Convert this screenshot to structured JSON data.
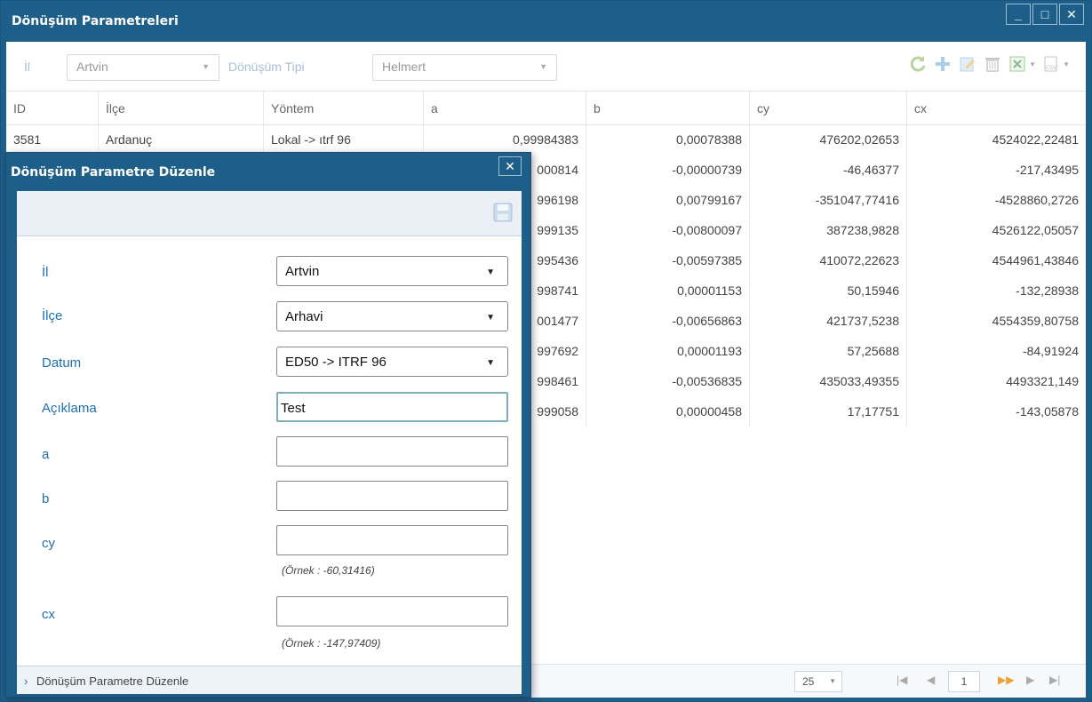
{
  "main": {
    "title": "Dönüşüm Parametreleri",
    "win_minimize": "_",
    "win_maximize": "□",
    "win_close": "✕"
  },
  "toolbar": {
    "il_label": "İl",
    "il_value": "Artvin",
    "tip_label": "Dönüşüm Tipi",
    "tip_value": "Helmert",
    "icons": [
      "refresh-icon",
      "add-icon",
      "edit-icon",
      "delete-icon",
      "excel-export-icon",
      "csv-export-icon"
    ]
  },
  "grid": {
    "headers": [
      "ID",
      "İlçe",
      "Yöntem",
      "a",
      "b",
      "cy",
      "cx"
    ],
    "rows": [
      [
        "3581",
        "Ardanuç",
        "Lokal -> ıtrf 96",
        "0,99984383",
        "0,00078388",
        "476202,02653",
        "4524022,22481"
      ],
      [
        "",
        "",
        "",
        "000814",
        "-0,00000739",
        "-46,46377",
        "-217,43495"
      ],
      [
        "",
        "",
        "",
        "996198",
        "0,00799167",
        "-351047,77416",
        "-4528860,2726"
      ],
      [
        "",
        "",
        "",
        "999135",
        "-0,00800097",
        "387238,9828",
        "4526122,05057"
      ],
      [
        "",
        "",
        "",
        "995436",
        "-0,00597385",
        "410072,22623",
        "4544961,43846"
      ],
      [
        "",
        "",
        "",
        "998741",
        "0,00001153",
        "50,15946",
        "-132,28938"
      ],
      [
        "",
        "",
        "",
        "001477",
        "-0,00656863",
        "421737,5238",
        "4554359,80758"
      ],
      [
        "",
        "",
        "",
        "997692",
        "0,00001193",
        "57,25688",
        "-84,91924"
      ],
      [
        "",
        "",
        "",
        "998461",
        "-0,00536835",
        "435033,49355",
        "4493321,149"
      ],
      [
        "",
        "",
        "",
        "999058",
        "0,00000458",
        "17,17751",
        "-143,05878"
      ]
    ]
  },
  "pager": {
    "page_size": "25",
    "page": "1",
    "first": "|◀",
    "prev": "◀",
    "next": "▶▶",
    "next2": "▶",
    "last": "▶|"
  },
  "dialog": {
    "title": "Dönüşüm Parametre Düzenle",
    "close": "✕",
    "fields": {
      "il_label": "İl",
      "il_value": "Artvin",
      "ilce_label": "İlçe",
      "ilce_value": "Arhavi",
      "datum_label": "Datum",
      "datum_value": "ED50 -> ITRF 96",
      "aciklama_label": "Açıklama",
      "aciklama_value": "Test",
      "a_label": "a",
      "a_value": "",
      "b_label": "b",
      "b_value": "",
      "cy_label": "cy",
      "cy_value": "",
      "cy_hint": "(Örnek : -60,31416)",
      "cx_label": "cx",
      "cx_value": "",
      "cx_hint": "(Örnek : -147,97409)"
    },
    "footer": "Dönüşüm Parametre Düzenle",
    "footer_arrow": "›"
  },
  "colors": {
    "window_blue": "#1e5f8a",
    "label_blue": "#1f6fb3",
    "toolbar_label": "#a8c0d8"
  }
}
